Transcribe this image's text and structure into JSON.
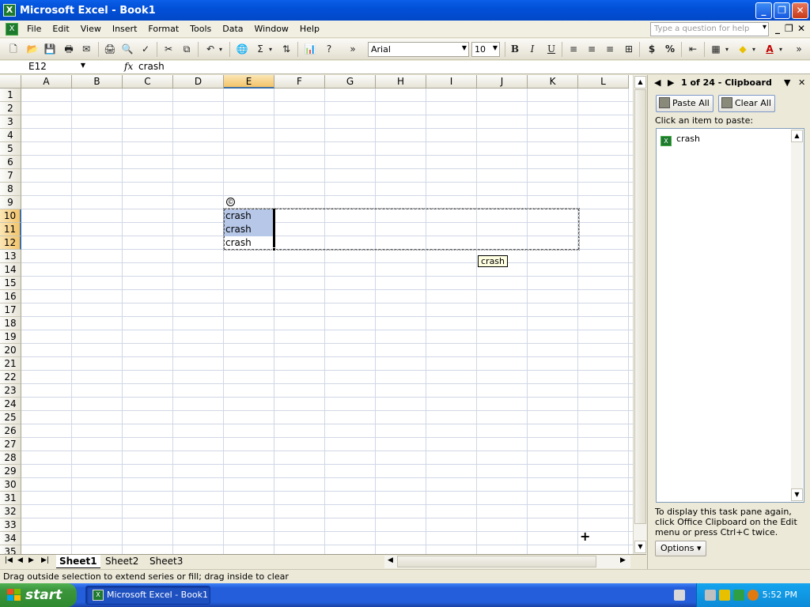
{
  "window": {
    "title": "Microsoft Excel - Book1"
  },
  "menus": [
    "File",
    "Edit",
    "View",
    "Insert",
    "Format",
    "Tools",
    "Data",
    "Window",
    "Help"
  ],
  "help_box": {
    "placeholder": "Type a question for help"
  },
  "toolbar": {
    "font": "Arial",
    "size": "10",
    "bold": "B",
    "italic": "I",
    "underline": "U",
    "currency": "$",
    "percent": "%"
  },
  "formula_bar": {
    "name_box": "E12",
    "fx": "fx",
    "value": "crash"
  },
  "columns": [
    "A",
    "B",
    "C",
    "D",
    "E",
    "F",
    "G",
    "H",
    "I",
    "J",
    "K",
    "L"
  ],
  "rows": [
    "1",
    "2",
    "3",
    "4",
    "5",
    "6",
    "7",
    "8",
    "9",
    "10",
    "11",
    "12",
    "13",
    "14",
    "15",
    "16",
    "17",
    "18",
    "19",
    "20",
    "21",
    "22",
    "23",
    "24",
    "25",
    "26",
    "27",
    "28",
    "29",
    "30",
    "31",
    "32",
    "33",
    "34",
    "35"
  ],
  "cells": [
    {
      "ref": "E10",
      "value": "crash"
    },
    {
      "ref": "E11",
      "value": "crash"
    },
    {
      "ref": "E12",
      "value": "crash"
    }
  ],
  "selected_column": "E",
  "selected_rows": [
    "10",
    "11",
    "12"
  ],
  "drag_tooltip": "crash",
  "sheet_tabs": [
    "Sheet1",
    "Sheet2",
    "Sheet3"
  ],
  "active_sheet": "Sheet1",
  "status_text": "Drag outside selection to extend series or fill; drag inside to clear",
  "task_pane": {
    "title": "1 of 24 - Clipboard",
    "paste_all": "Paste All",
    "clear_all": "Clear All",
    "instruction": "Click an item to paste:",
    "items": [
      "crash"
    ],
    "note": "To display this task pane again, click Office Clipboard on the Edit menu or press Ctrl+C twice.",
    "options": "Options"
  },
  "taskbar": {
    "start": "start",
    "item": "Microsoft Excel - Book1",
    "clock": "5:52 PM"
  },
  "colors": {
    "title_bar": "#0350d8",
    "selection": "#b6c7e8",
    "header_highlight": "#f3c36a",
    "start_button": "#3c953c"
  }
}
